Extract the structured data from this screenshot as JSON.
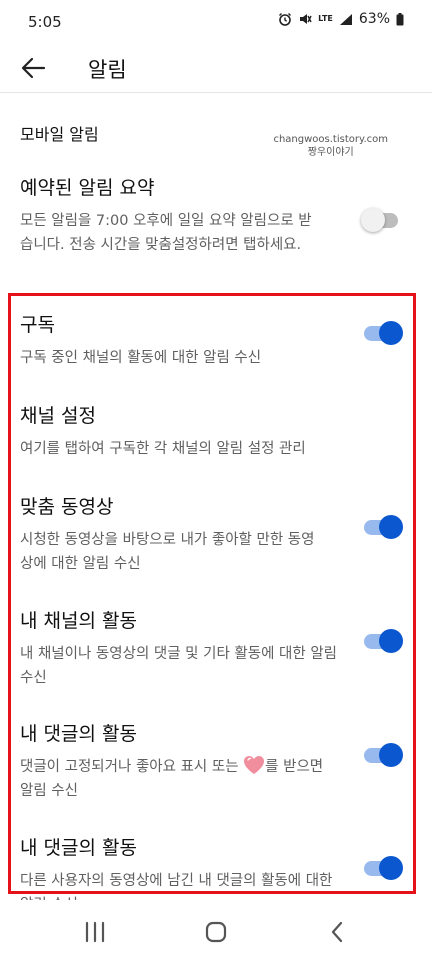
{
  "status_bar": {
    "time": "5:05",
    "network": "LTE",
    "battery": "63%"
  },
  "app_bar": {
    "title": "알림"
  },
  "section": {
    "header": "모바일 알림"
  },
  "watermark": {
    "line1": "changwoos.tistory.com",
    "line2": "짱우이야기"
  },
  "settings": [
    {
      "title": "예약된 알림 요약",
      "desc": "모든 알림을 7:00 오후에 일일 요약 알림으로 받습니다. 전송 시간을 맞춤설정하려면 탭하세요.",
      "toggle": "off"
    },
    {
      "title": "구독",
      "desc": "구독 중인 채널의 활동에 대한 알림 수신",
      "toggle": "on"
    },
    {
      "title": "채널 설정",
      "desc": "여기를 탭하여 구독한 각 채널의 알림 설정 관리",
      "toggle": "none"
    },
    {
      "title": "맞춤 동영상",
      "desc": "시청한 동영상을 바탕으로 내가 좋아할 만한 동영상에 대한 알림 수신",
      "toggle": "on"
    },
    {
      "title": "내 채널의 활동",
      "desc": "내 채널이나 동영상의 댓글 및 기타 활동에 대한 알림 수신",
      "toggle": "on"
    },
    {
      "title": "내 댓글의 활동",
      "desc_before": "댓글이 고정되거나 좋아요 표시 또는",
      "desc_after": "를 받으면 알림 수신",
      "toggle": "on"
    },
    {
      "title": "내 댓글의 활동",
      "desc": "다른 사용자의 동영상에 남긴 내 댓글의 활동에 대한 알림 수신",
      "toggle": "on"
    }
  ],
  "colors": {
    "accent": "#0b57d0",
    "accent_track": "#98b9ee",
    "highlight": "#e5121a"
  },
  "icons": {
    "back": "arrow-left-icon",
    "heart": "heart-icon",
    "nav_recent": "recent-apps-icon",
    "nav_home": "home-icon",
    "nav_back": "chevron-left-icon"
  }
}
